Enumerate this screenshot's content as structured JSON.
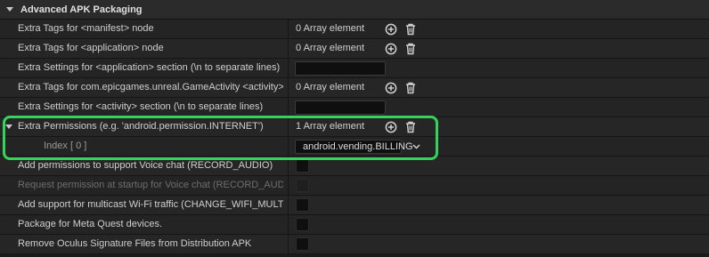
{
  "section": {
    "title": "Advanced APK Packaging"
  },
  "rows": [
    {
      "label": "Extra Tags for <manifest> node",
      "value": "0 Array element"
    },
    {
      "label": "Extra Tags for <application> node",
      "value": "0 Array element"
    },
    {
      "label": "Extra Settings for <application> section (\\n to separate lines)"
    },
    {
      "label": "Extra Tags for com.epicgames.unreal.GameActivity <activity> node",
      "value": "0 Array element"
    },
    {
      "label": "Extra Settings for <activity> section (\\n to separate lines)"
    },
    {
      "label": "Extra Permissions (e.g. 'android.permission.INTERNET')",
      "value": "1 Array element"
    },
    {
      "label": "Index [ 0 ]",
      "value": "android.vending.BILLING"
    },
    {
      "label": "Add permissions to support Voice chat (RECORD_AUDIO)"
    },
    {
      "label": "Request permission at startup for Voice chat (RECORD_AUDIO)"
    },
    {
      "label": "Add support for multicast Wi-Fi traffic (CHANGE_WIFI_MULTICAST_STA..."
    },
    {
      "label": "Package for Meta Quest devices."
    },
    {
      "label": "Remove Oculus Signature Files from Distribution APK"
    }
  ],
  "colors": {
    "highlight": "#33d35c",
    "background": "#242424"
  }
}
